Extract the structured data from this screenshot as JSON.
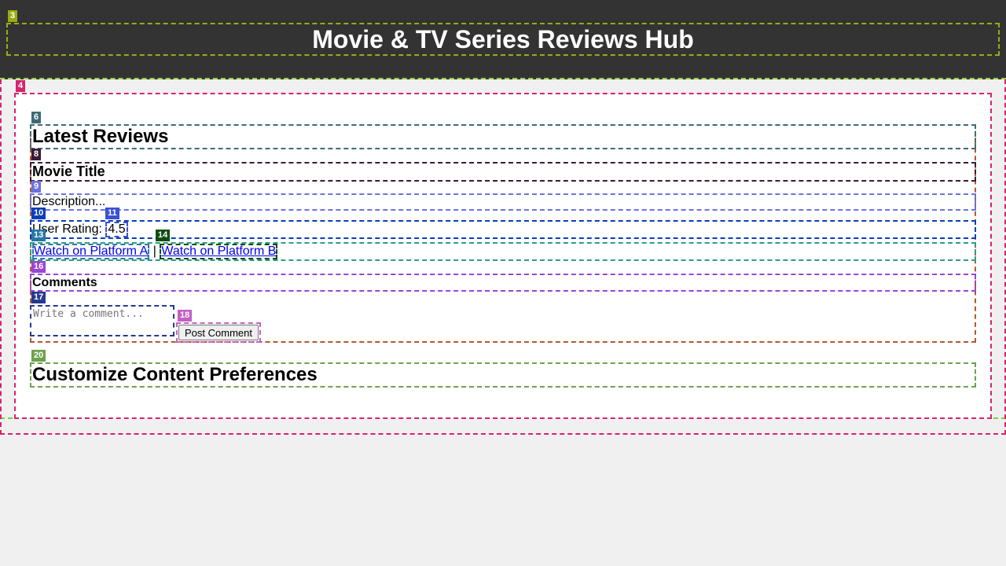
{
  "header": {
    "title": "Movie & TV Series Reviews Hub"
  },
  "reviews": {
    "section_title": "Latest Reviews",
    "movie_title": "Movie Title",
    "description": "Description...",
    "rating_label": "User Rating:",
    "rating_value": "4.5",
    "platform_a": "Watch on Platform A",
    "separator": "|",
    "platform_b": "Watch on Platform B",
    "comments_title": "Comments",
    "comment_placeholder": "Write a comment...",
    "post_button": "Post Comment"
  },
  "preferences": {
    "section_title": "Customize Content Preferences"
  },
  "badges": {
    "header_title": "3",
    "main": "4",
    "latest_title": "6",
    "movie_title": "8",
    "description": "9",
    "rating_row": "10",
    "rating_value": "11",
    "watch_row": "13",
    "platform_b": "14",
    "comments_title": "16",
    "comment_input": "17",
    "post_button": "18",
    "prefs_title": "20"
  },
  "colors": {
    "header_bg": "#333333",
    "page_bg": "#f0f0f0",
    "card_bg": "#ffffff",
    "link": "#0000ee"
  }
}
